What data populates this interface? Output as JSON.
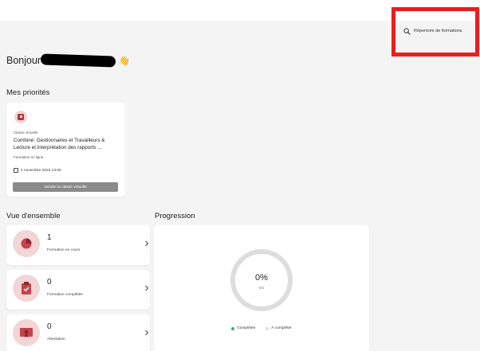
{
  "header": {
    "catalog_link": "Répertoire de formations",
    "catalog_icon": "search-icon"
  },
  "greeting": {
    "text": "Bonjour",
    "emoji": "👋"
  },
  "priorities": {
    "title": "Mes priorités",
    "card": {
      "type": "Classe virtuelle",
      "course_title": "Combiné: Gestionnaires et Travailleurs & Lecture et interprétation des rapports ...",
      "mode": "Formation en ligne",
      "date": "2 novembre 2023 13:00",
      "button_label": "Joindre la classe virtuelle"
    }
  },
  "overview": {
    "title": "Vue d'ensemble",
    "items": [
      {
        "count": "1",
        "label": "Formation en cours",
        "icon": "pie-chart-icon"
      },
      {
        "count": "0",
        "label": "Formation complétée",
        "icon": "clipboard-check-icon"
      },
      {
        "count": "0",
        "label": "Attestation",
        "icon": "certificate-icon"
      }
    ]
  },
  "progression": {
    "title": "Progression",
    "percent_label": "0%",
    "fraction_label": "0/1",
    "completed_fraction": 0,
    "legend": [
      {
        "label": "Complétée",
        "color": "#2bb673"
      },
      {
        "label": "À compléter",
        "color": "#dddddd"
      }
    ]
  },
  "colors": {
    "accent": "#b8323a",
    "accent_soft": "#f2d5d5",
    "button_gray": "#8a8a8a",
    "highlight": "#ee1c1c"
  }
}
